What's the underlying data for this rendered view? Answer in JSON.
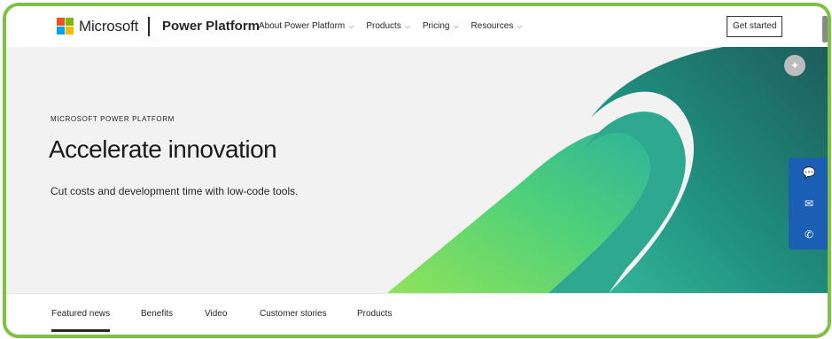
{
  "header": {
    "brand": "Microsoft",
    "product": "Power Platform",
    "nav": [
      {
        "label": "About Power Platform"
      },
      {
        "label": "Products"
      },
      {
        "label": "Pricing"
      },
      {
        "label": "Resources"
      }
    ],
    "cta_label": "Get started"
  },
  "hero": {
    "eyebrow": "MICROSOFT POWER PLATFORM",
    "title": "Accelerate innovation",
    "subtitle": "Cut costs and development time with low-code tools."
  },
  "tabs": [
    {
      "label": "Featured news",
      "active": true
    },
    {
      "label": "Benefits"
    },
    {
      "label": "Video"
    },
    {
      "label": "Customer stories"
    },
    {
      "label": "Products"
    }
  ],
  "colors": {
    "frame": "#7dc242",
    "rail": "#1a5fb4",
    "logo_red": "#f25022",
    "logo_green": "#7fba00",
    "logo_blue": "#00a4ef",
    "logo_yellow": "#ffb900"
  },
  "icons": {
    "copilot": "copilot-icon",
    "chat": "chat-icon",
    "mail": "mail-icon",
    "phone": "phone-icon",
    "chevron": "chevron-down-icon"
  }
}
